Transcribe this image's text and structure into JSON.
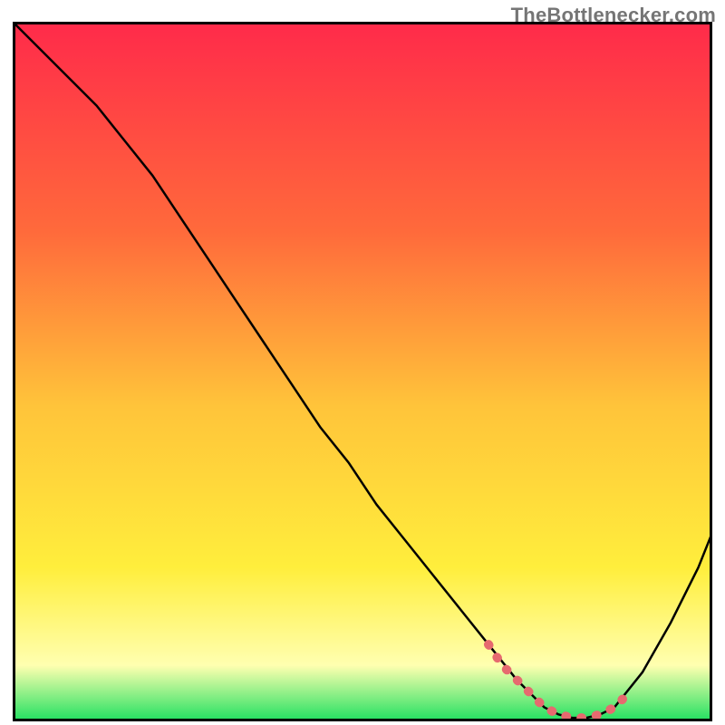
{
  "attribution": "TheBottlenecker.com",
  "colors": {
    "gradient_top": "#ff2a4a",
    "gradient_mid1": "#ff6a3b",
    "gradient_mid2": "#ffc43a",
    "gradient_mid3": "#ffee3c",
    "gradient_pale": "#ffffb0",
    "gradient_bottom": "#1fe060",
    "curve": "#000000",
    "marker": "#e66a6f",
    "frame": "#000000"
  },
  "chart_data": {
    "type": "line",
    "title": "",
    "xlabel": "",
    "ylabel": "",
    "xlim": [
      0,
      100
    ],
    "ylim": [
      0,
      100
    ],
    "series": [
      {
        "name": "bottleneck-curve",
        "x": [
          0,
          4,
          8,
          12,
          16,
          20,
          24,
          28,
          32,
          36,
          40,
          44,
          48,
          52,
          56,
          60,
          64,
          68,
          72,
          74,
          76,
          78,
          80,
          82,
          84,
          86,
          90,
          94,
          98,
          100
        ],
        "y": [
          100,
          96,
          92,
          88,
          83,
          78,
          72,
          66,
          60,
          54,
          48,
          42,
          37,
          31,
          26,
          21,
          16,
          11,
          6,
          4,
          2,
          1,
          0.5,
          0.5,
          1,
          2,
          7,
          14,
          22,
          27
        ]
      }
    ],
    "markers": {
      "name": "highlight-segment",
      "x": [
        68,
        70,
        72,
        74,
        76,
        78,
        80,
        82,
        84,
        86,
        88
      ],
      "y": [
        11,
        8,
        6,
        4,
        2,
        1,
        0.5,
        0.5,
        1,
        2,
        4
      ]
    },
    "grid": false,
    "legend": false
  }
}
